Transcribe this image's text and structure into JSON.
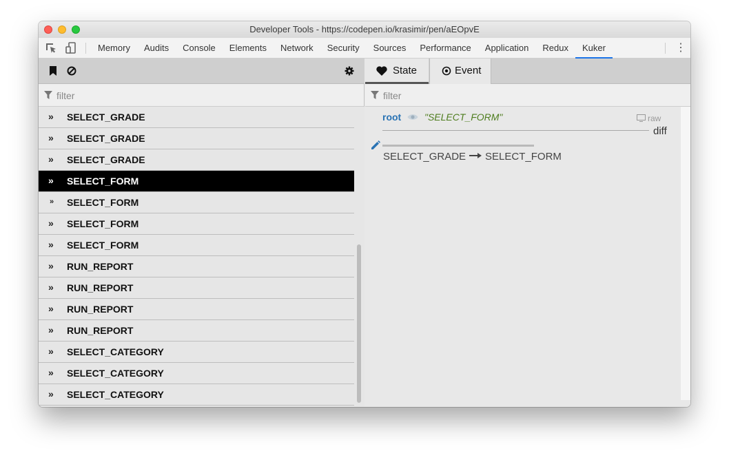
{
  "window": {
    "title": "Developer Tools - https://codepen.io/krasimir/pen/aEOpvE"
  },
  "devtools_tabs": [
    {
      "label": "Memory"
    },
    {
      "label": "Audits"
    },
    {
      "label": "Console"
    },
    {
      "label": "Elements"
    },
    {
      "label": "Network"
    },
    {
      "label": "Security"
    },
    {
      "label": "Sources"
    },
    {
      "label": "Performance"
    },
    {
      "label": "Application"
    },
    {
      "label": "Redux"
    },
    {
      "label": "Kuker",
      "active": true
    }
  ],
  "left_panel": {
    "filter_placeholder": "filter",
    "events": [
      {
        "label": "SELECT_GRADE"
      },
      {
        "label": "SELECT_GRADE"
      },
      {
        "label": "SELECT_GRADE"
      },
      {
        "label": "SELECT_FORM",
        "selected": true
      },
      {
        "label": "SELECT_FORM"
      },
      {
        "label": "SELECT_FORM"
      },
      {
        "label": "SELECT_FORM"
      },
      {
        "label": "RUN_REPORT"
      },
      {
        "label": "RUN_REPORT"
      },
      {
        "label": "RUN_REPORT"
      },
      {
        "label": "RUN_REPORT"
      },
      {
        "label": "SELECT_CATEGORY"
      },
      {
        "label": "SELECT_CATEGORY"
      },
      {
        "label": "SELECT_CATEGORY"
      }
    ]
  },
  "right_panel": {
    "tabs": {
      "state": "State",
      "event": "Event"
    },
    "filter_placeholder": "filter",
    "root_label": "root",
    "root_value": "\"SELECT_FORM\"",
    "raw_label": "raw",
    "diff_label": "diff",
    "transition": {
      "from": "SELECT_GRADE",
      "to": "SELECT_FORM"
    }
  },
  "colors": {
    "active_tab_underline": "#1a73e8",
    "root_label": "#2a73b4",
    "root_value": "#4e7d1e",
    "selected_row": "#000000"
  }
}
